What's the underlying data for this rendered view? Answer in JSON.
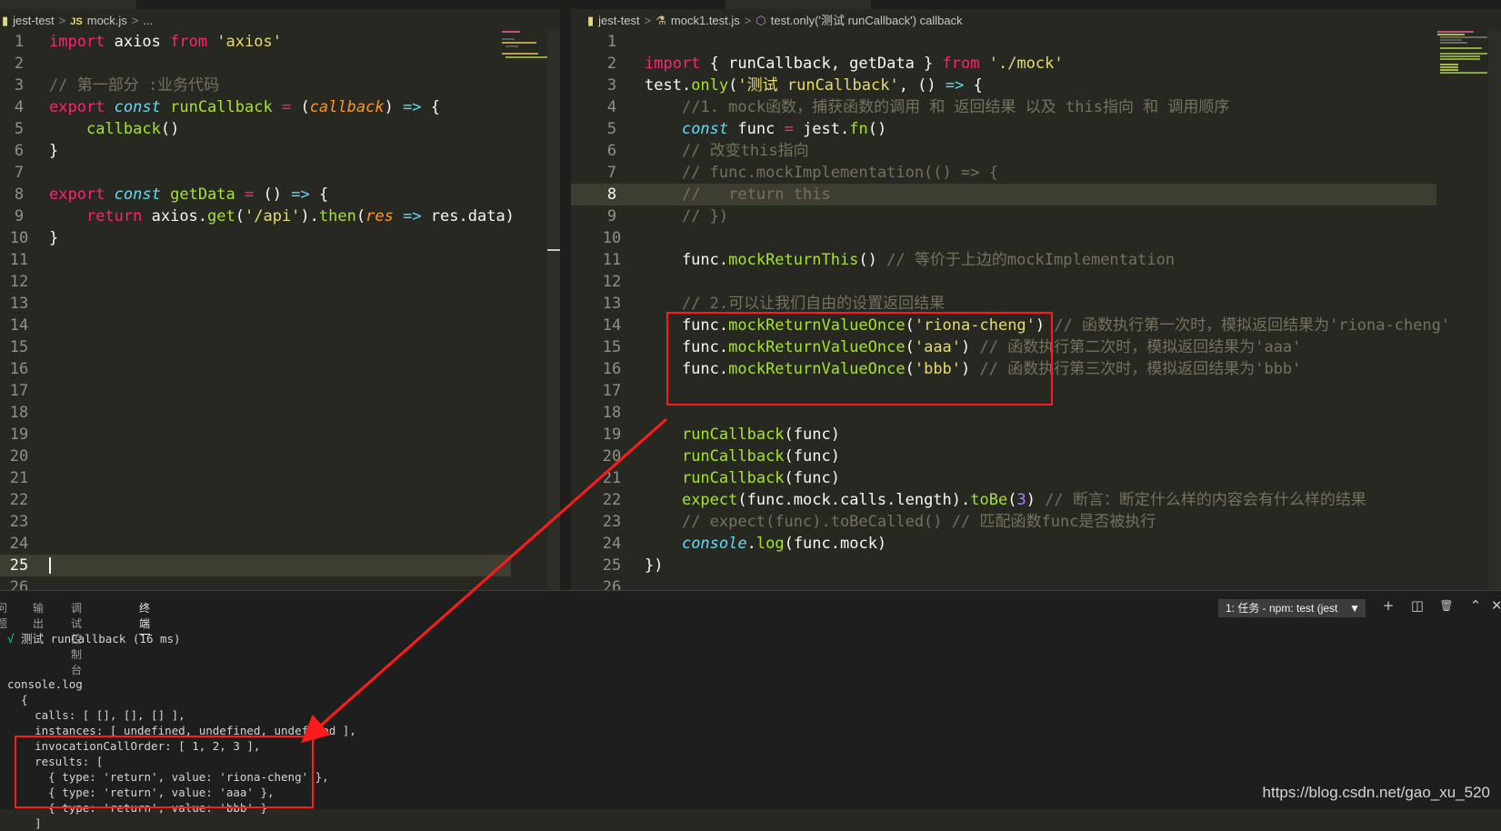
{
  "left": {
    "breadcrumb": [
      "jest-test",
      ">",
      "JS",
      "mock.js",
      ">",
      "..."
    ],
    "lines": [
      {
        "n": "1",
        "html": "<span class='k'>import</span> axios <span class='k'>from</span> <span class='s'>'axios'</span>"
      },
      {
        "n": "2",
        "html": ""
      },
      {
        "n": "3",
        "html": "<span class='c'>// 第一部分 :业务代码</span>"
      },
      {
        "n": "4",
        "html": "<span class='k'>export</span> <span class='sb'>const</span> <span class='f'>runCallback</span> <span class='k'>=</span> (<span class='p'>callback</span>) <span class='sb' style='font-style:normal'>=&gt;</span> {"
      },
      {
        "n": "5",
        "html": "    <span class='f'>callback</span>()"
      },
      {
        "n": "6",
        "html": "}"
      },
      {
        "n": "7",
        "html": ""
      },
      {
        "n": "8",
        "html": "<span class='k'>export</span> <span class='sb'>const</span> <span class='f'>getData</span> <span class='k'>=</span> () <span class='sb' style='font-style:normal'>=&gt;</span> {"
      },
      {
        "n": "9",
        "html": "    <span class='k'>return</span> axios.<span class='f'>get</span>(<span class='s'>'/api'</span>).<span class='f'>then</span>(<span class='p'>res</span> <span class='sb' style='font-style:normal'>=&gt;</span> res.data)"
      },
      {
        "n": "10",
        "html": "}"
      },
      {
        "n": "11",
        "html": ""
      },
      {
        "n": "12",
        "html": ""
      },
      {
        "n": "13",
        "html": ""
      },
      {
        "n": "14",
        "html": ""
      },
      {
        "n": "15",
        "html": ""
      },
      {
        "n": "16",
        "html": ""
      },
      {
        "n": "17",
        "html": ""
      },
      {
        "n": "18",
        "html": ""
      },
      {
        "n": "19",
        "html": ""
      },
      {
        "n": "20",
        "html": ""
      },
      {
        "n": "21",
        "html": ""
      },
      {
        "n": "22",
        "html": ""
      },
      {
        "n": "23",
        "html": ""
      },
      {
        "n": "24",
        "html": ""
      },
      {
        "n": "25",
        "html": "",
        "current": true
      },
      {
        "n": "26",
        "html": ""
      }
    ]
  },
  "right": {
    "breadcrumb": [
      "jest-test",
      ">",
      "mock1.test.js",
      ">",
      "test.only('测试 runCallback') callback"
    ],
    "lines": [
      {
        "n": "1",
        "html": ""
      },
      {
        "n": "2",
        "html": "<span class='k'>import</span> { runCallback, getData } <span class='k'>from</span> <span class='s'>'./mock'</span>"
      },
      {
        "n": "3",
        "html": "test.<span class='f'>only</span>(<span class='s'>'测试 runCallback'</span>, () <span class='sb' style='font-style:normal'>=&gt;</span> {"
      },
      {
        "n": "4",
        "html": "    <span class='c'>//1. mock函数，捕获函数的调用 和 返回结果 以及 this指向 和 调用顺序</span>"
      },
      {
        "n": "5",
        "html": "    <span class='sb'>const</span> func <span class='k'>=</span> jest.<span class='f'>fn</span>()"
      },
      {
        "n": "6",
        "html": "    <span class='c'>// 改变this指向</span>"
      },
      {
        "n": "7",
        "html": "    <span class='c'>// func.mockImplementation(() =&gt; {</span>"
      },
      {
        "n": "8",
        "html": "    <span class='c'>//   return this</span>",
        "current": true
      },
      {
        "n": "9",
        "html": "    <span class='c'>// })</span>"
      },
      {
        "n": "10",
        "html": ""
      },
      {
        "n": "11",
        "html": "    func.<span class='f'>mockReturnThis</span>() <span class='c'>// 等价于上边的mockImplementation</span>"
      },
      {
        "n": "12",
        "html": ""
      },
      {
        "n": "13",
        "html": "    <span class='c'>// 2.可以让我们自由的设置返回结果</span>"
      },
      {
        "n": "14",
        "html": "    func.<span class='f'>mockReturnValueOnce</span>(<span class='s'>'riona-cheng'</span>) <span class='c'>// 函数执行第一次时，模拟返回结果为'riona-cheng'</span>"
      },
      {
        "n": "15",
        "html": "    func.<span class='f'>mockReturnValueOnce</span>(<span class='s'>'aaa'</span>) <span class='c'>// 函数执行第二次时，模拟返回结果为'aaa'</span>"
      },
      {
        "n": "16",
        "html": "    func.<span class='f'>mockReturnValueOnce</span>(<span class='s'>'bbb'</span>) <span class='c'>// 函数执行第三次时，模拟返回结果为'bbb'</span>"
      },
      {
        "n": "17",
        "html": ""
      },
      {
        "n": "18",
        "html": ""
      },
      {
        "n": "19",
        "html": "    <span class='f'>runCallback</span>(func)"
      },
      {
        "n": "20",
        "html": "    <span class='f'>runCallback</span>(func)"
      },
      {
        "n": "21",
        "html": "    <span class='f'>runCallback</span>(func)"
      },
      {
        "n": "22",
        "html": "    <span class='f'>expect</span>(func.mock.calls.length).<span class='f'>toBe</span>(<span class='n'>3</span>) <span class='c'>// 断言：断定什么样的内容会有什么样的结果</span>"
      },
      {
        "n": "23",
        "html": "    <span class='c'>// expect(func).toBeCalled() // 匹配函数func是否被执行</span>"
      },
      {
        "n": "24",
        "html": "    <span class='sb'>console</span>.<span class='f'>log</span>(func.mock)"
      },
      {
        "n": "25",
        "html": "})"
      },
      {
        "n": "26",
        "html": ""
      }
    ]
  },
  "panel": {
    "tabs": [
      "问题",
      "输出",
      "调试控制台",
      "终端"
    ],
    "active_tab": "终端",
    "task": "1: 任务 - npm: test (jest",
    "task_caret": "▼",
    "icons": [
      "plus-icon",
      "split-icon",
      "trash-icon",
      "chevron-up-icon",
      "close-icon"
    ],
    "icon_glyphs": [
      "+",
      "◫",
      "🗑",
      "⌃",
      "✕"
    ],
    "terminal": [
      {
        "html": "<span class='ok'>√</span> 测试 runCallback (16 ms)"
      },
      {
        "html": ""
      },
      {
        "html": "console.log"
      },
      {
        "html": "  {"
      },
      {
        "html": "    calls: [ [], [], [] ],"
      },
      {
        "html": "    instances: [ undefined, undefined, undefined ],"
      },
      {
        "html": "    invocationCallOrder: [ 1, 2, 3 ],"
      },
      {
        "html": "    results: ["
      },
      {
        "html": "      { type: 'return', value: 'riona-cheng' },"
      },
      {
        "html": "      { type: 'return', value: 'aaa' },"
      },
      {
        "html": "      { type: 'return', value: 'bbb' }"
      },
      {
        "html": "    ]"
      }
    ]
  },
  "watermark": "https://blog.csdn.net/gao_xu_520",
  "colors": {
    "annotation_red": "#ff1b1b",
    "editor_bg": "#272822",
    "panel_bg": "#1e1e1e"
  }
}
